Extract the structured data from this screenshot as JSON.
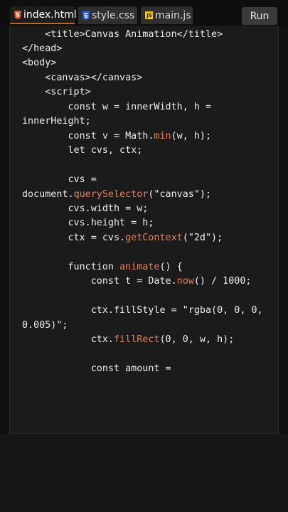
{
  "tabs": [
    {
      "label": "index.html",
      "icon": "html5-icon",
      "active": true
    },
    {
      "label": "style.css",
      "icon": "css3-icon",
      "active": false
    },
    {
      "label": "main.js",
      "icon": "js-icon",
      "active": false
    }
  ],
  "run_label": "Run",
  "colors": {
    "background": "#101010",
    "editor": "#1b1b1b",
    "function_highlight": "#e2835a",
    "text": "#ededed",
    "html_icon": "#e44d26",
    "css_icon": "#2965f1",
    "js_icon": "#e8c02a"
  },
  "code": {
    "l1": "    <title>Canvas Animation</title>",
    "l2": "</head>",
    "l3": "<body>",
    "l4": "    <canvas></canvas>",
    "l5": "    <script>",
    "l6": "        const w = innerWidth, h =",
    "l7": "innerHeight;",
    "l8a": "        const v = Math.",
    "l8b": "min",
    "l8c": "(w, h);",
    "l9": "        let cvs, ctx;",
    "l10": "        cvs =",
    "l11a": "document.",
    "l11b": "querySelector",
    "l11c": "(\"canvas\");",
    "l12": "        cvs.width = w;",
    "l13": "        cvs.height = h;",
    "l14a": "        ctx = cvs.",
    "l14b": "getContext",
    "l14c": "(\"2d\");",
    "l15a": "        function ",
    "l15b": "animate",
    "l15c": "() {",
    "l16a": "            const t = Date.",
    "l16b": "now",
    "l16c": "() / 1000;",
    "l17": "            ctx.fillStyle = \"rgba(0, 0, 0,",
    "l18": "0.005)\";",
    "l19a": "            ctx.",
    "l19b": "fillRect",
    "l19c": "(0, 0, w, h);",
    "l20": "            const amount ="
  }
}
